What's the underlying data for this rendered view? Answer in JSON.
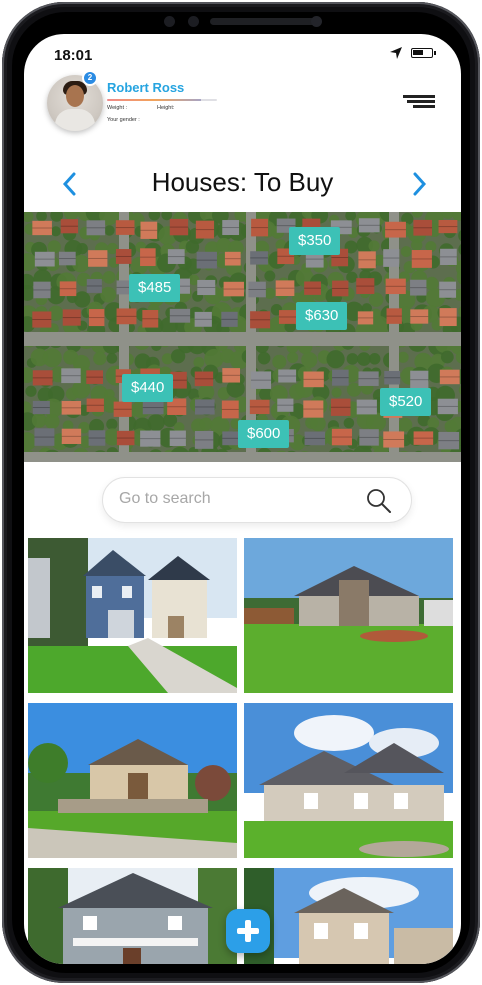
{
  "status": {
    "time": "18:01"
  },
  "profile": {
    "name": "Robert Ross",
    "notifications": "2",
    "weight_label": "Weight :",
    "height_label": "Height:",
    "gender_label": "Your gender :",
    "progress": 0.85
  },
  "header": {
    "title": "Houses: To Buy"
  },
  "map": {
    "prices": [
      "$350",
      "$485",
      "$630",
      "$440",
      "$520",
      "$600"
    ]
  },
  "search": {
    "placeholder": "Go to search"
  },
  "colors": {
    "accent": "#26a4e0",
    "price_tag": "#3cc1b6",
    "fab": "#2c9fe8"
  },
  "listings": [
    {
      "name": "blue-two-story-house"
    },
    {
      "name": "stone-front-house"
    },
    {
      "name": "hillside-bungalow"
    },
    {
      "name": "large-family-house"
    },
    {
      "name": "grey-craftsman-house"
    },
    {
      "name": "beige-suburban-house"
    }
  ]
}
